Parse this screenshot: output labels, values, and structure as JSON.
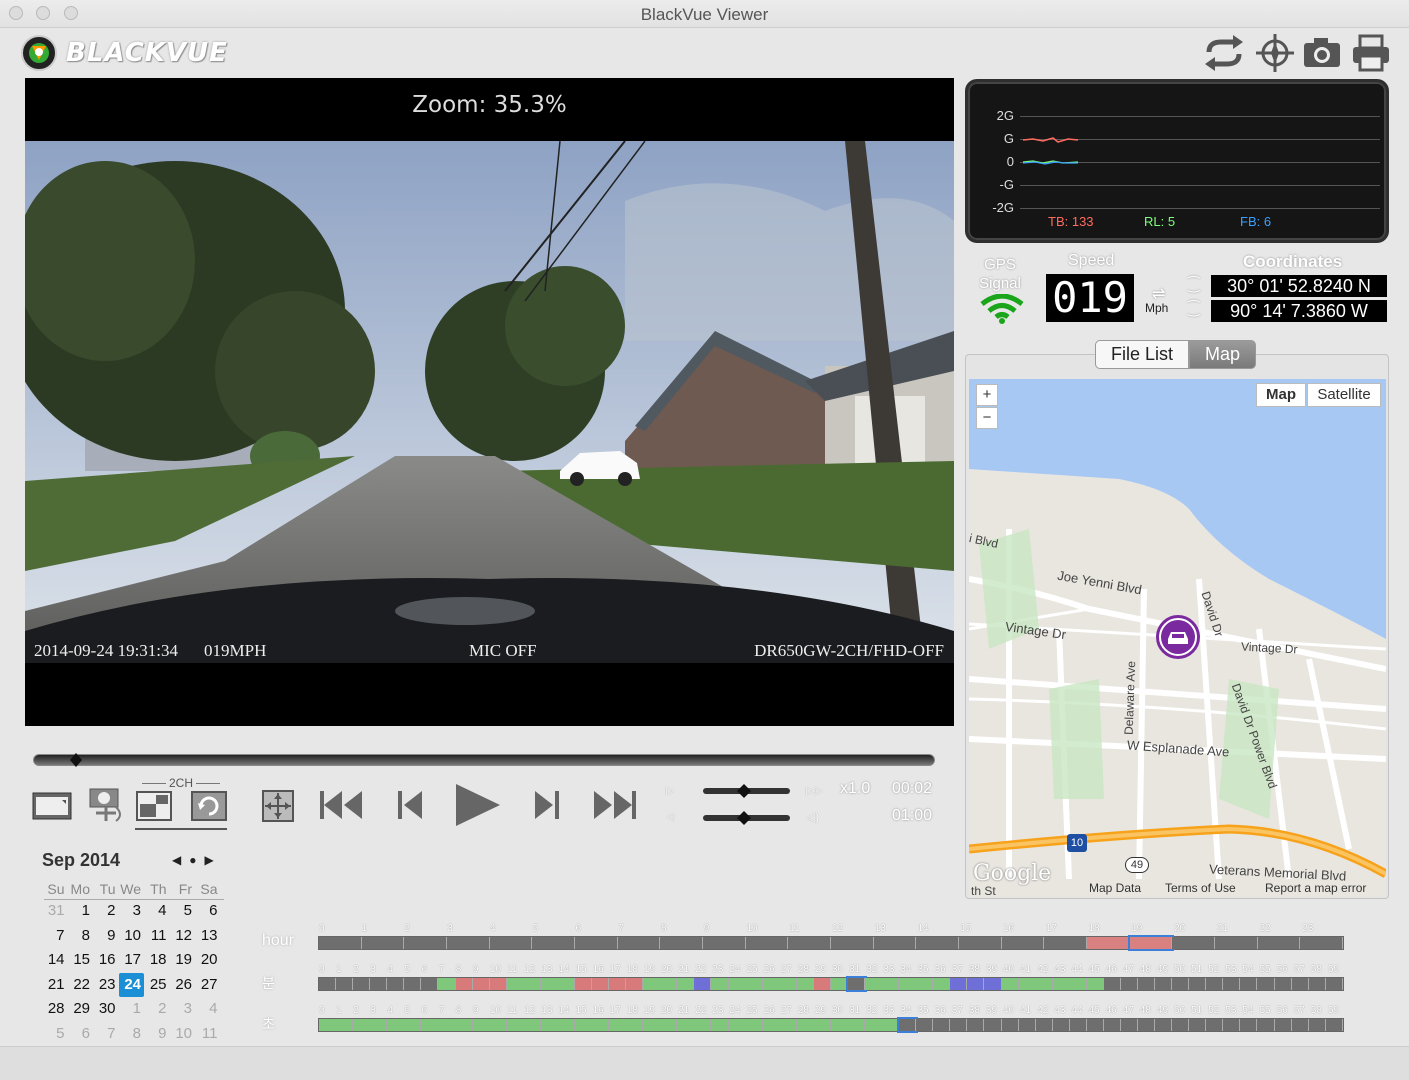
{
  "window": {
    "title": "BlackVue Viewer"
  },
  "app": {
    "logo_text": "BLACKVUE"
  },
  "toolbar": {
    "icons": [
      "repeat-icon",
      "compass-icon",
      "camera-icon",
      "print-icon"
    ]
  },
  "video": {
    "zoom_label": "Zoom: 35.3%",
    "osd_datetime": "2014-09-24  19:31:34",
    "osd_speed": "019MPH",
    "osd_mic": "MIC  OFF",
    "osd_model": "DR650GW-2CH/FHD-OFF"
  },
  "gsensor": {
    "axis_labels": [
      "2G",
      "G",
      "0",
      "-G",
      "-2G"
    ],
    "tb": "TB: 133",
    "rl": "RL: 5",
    "fb": "FB: 6",
    "colors": {
      "tb": "#ff6b5e",
      "rl": "#7cff7a",
      "fb": "#3aa0ff"
    }
  },
  "gps": {
    "label_line1": "GPS",
    "label_line2": "Signal"
  },
  "speed": {
    "label": "Speed",
    "value": "019",
    "unit": "Mph"
  },
  "coordinates": {
    "label": "Coordinates",
    "lat": "30° 01' 52.8240 N",
    "lon": "90° 14' 7.3860 W"
  },
  "tabs": {
    "file_list": "File List",
    "map": "Map"
  },
  "map": {
    "type_map": "Map",
    "type_satellite": "Satellite",
    "zoom_in": "+",
    "zoom_out": "−",
    "streets": {
      "joe_yenni": "Joe Yenni Blvd",
      "vintage_w": "Vintage Dr",
      "vintage_e": "Vintage Dr",
      "david": "David Dr",
      "david_power": "David Dr  Power Blvd",
      "delaware": "Delaware Ave",
      "esplanade": "W Esplanade Ave",
      "veterans": "Veterans Memorial Blvd",
      "i_blvd": "i Blvd",
      "th_st": "th St",
      "i10": "10",
      "r49": "49"
    },
    "google": "Google",
    "footer_data": "Map Data",
    "footer_terms": "Terms of Use",
    "footer_report": "Report a map error"
  },
  "playback": {
    "channel_label": "2CH",
    "rate": "x1.0",
    "elapsed": "00:02",
    "total": "01:00",
    "progress": 0.04
  },
  "calendar": {
    "month": "Sep 2014",
    "weekdays": [
      "Su",
      "Mo",
      "Tu",
      "We",
      "Th",
      "Fr",
      "Sa"
    ],
    "weeks": [
      [
        "31",
        "1",
        "2",
        "3",
        "4",
        "5",
        "6"
      ],
      [
        "7",
        "8",
        "9",
        "10",
        "11",
        "12",
        "13"
      ],
      [
        "14",
        "15",
        "16",
        "17",
        "18",
        "19",
        "20"
      ],
      [
        "21",
        "22",
        "23",
        "24",
        "25",
        "26",
        "27"
      ],
      [
        "28",
        "29",
        "30",
        "1",
        "2",
        "3",
        "4"
      ],
      [
        "5",
        "6",
        "7",
        "8",
        "9",
        "10",
        "11"
      ]
    ],
    "selected": "24"
  },
  "timeline": {
    "hour_label": "hour",
    "minute_label": "분",
    "second_label": "초"
  }
}
